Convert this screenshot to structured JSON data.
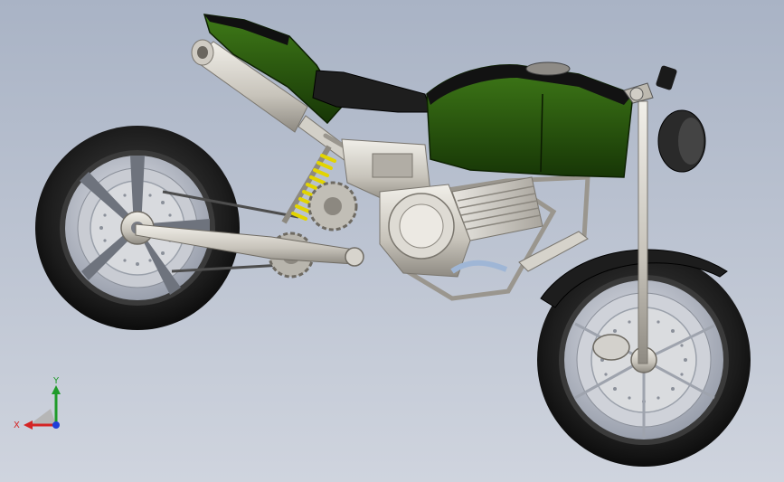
{
  "viewport": {
    "background_top": "#a9b3c5",
    "background_bottom": "#cfd4de"
  },
  "model": {
    "colors": {
      "body_green": "#2f5d12",
      "body_green_dark": "#173606",
      "seat_black": "#1a1a1a",
      "chrome": "#c9c6c0",
      "tire": "#1c1c1c",
      "rim": "#b9bcc4",
      "spring": "#e2d400",
      "hose": "#9fb6d6"
    }
  },
  "triad": {
    "x_label": "X",
    "y_label": "Y",
    "x_color": "#d42424",
    "y_color": "#1f9b2a",
    "z_color": "#1f3fd8"
  }
}
